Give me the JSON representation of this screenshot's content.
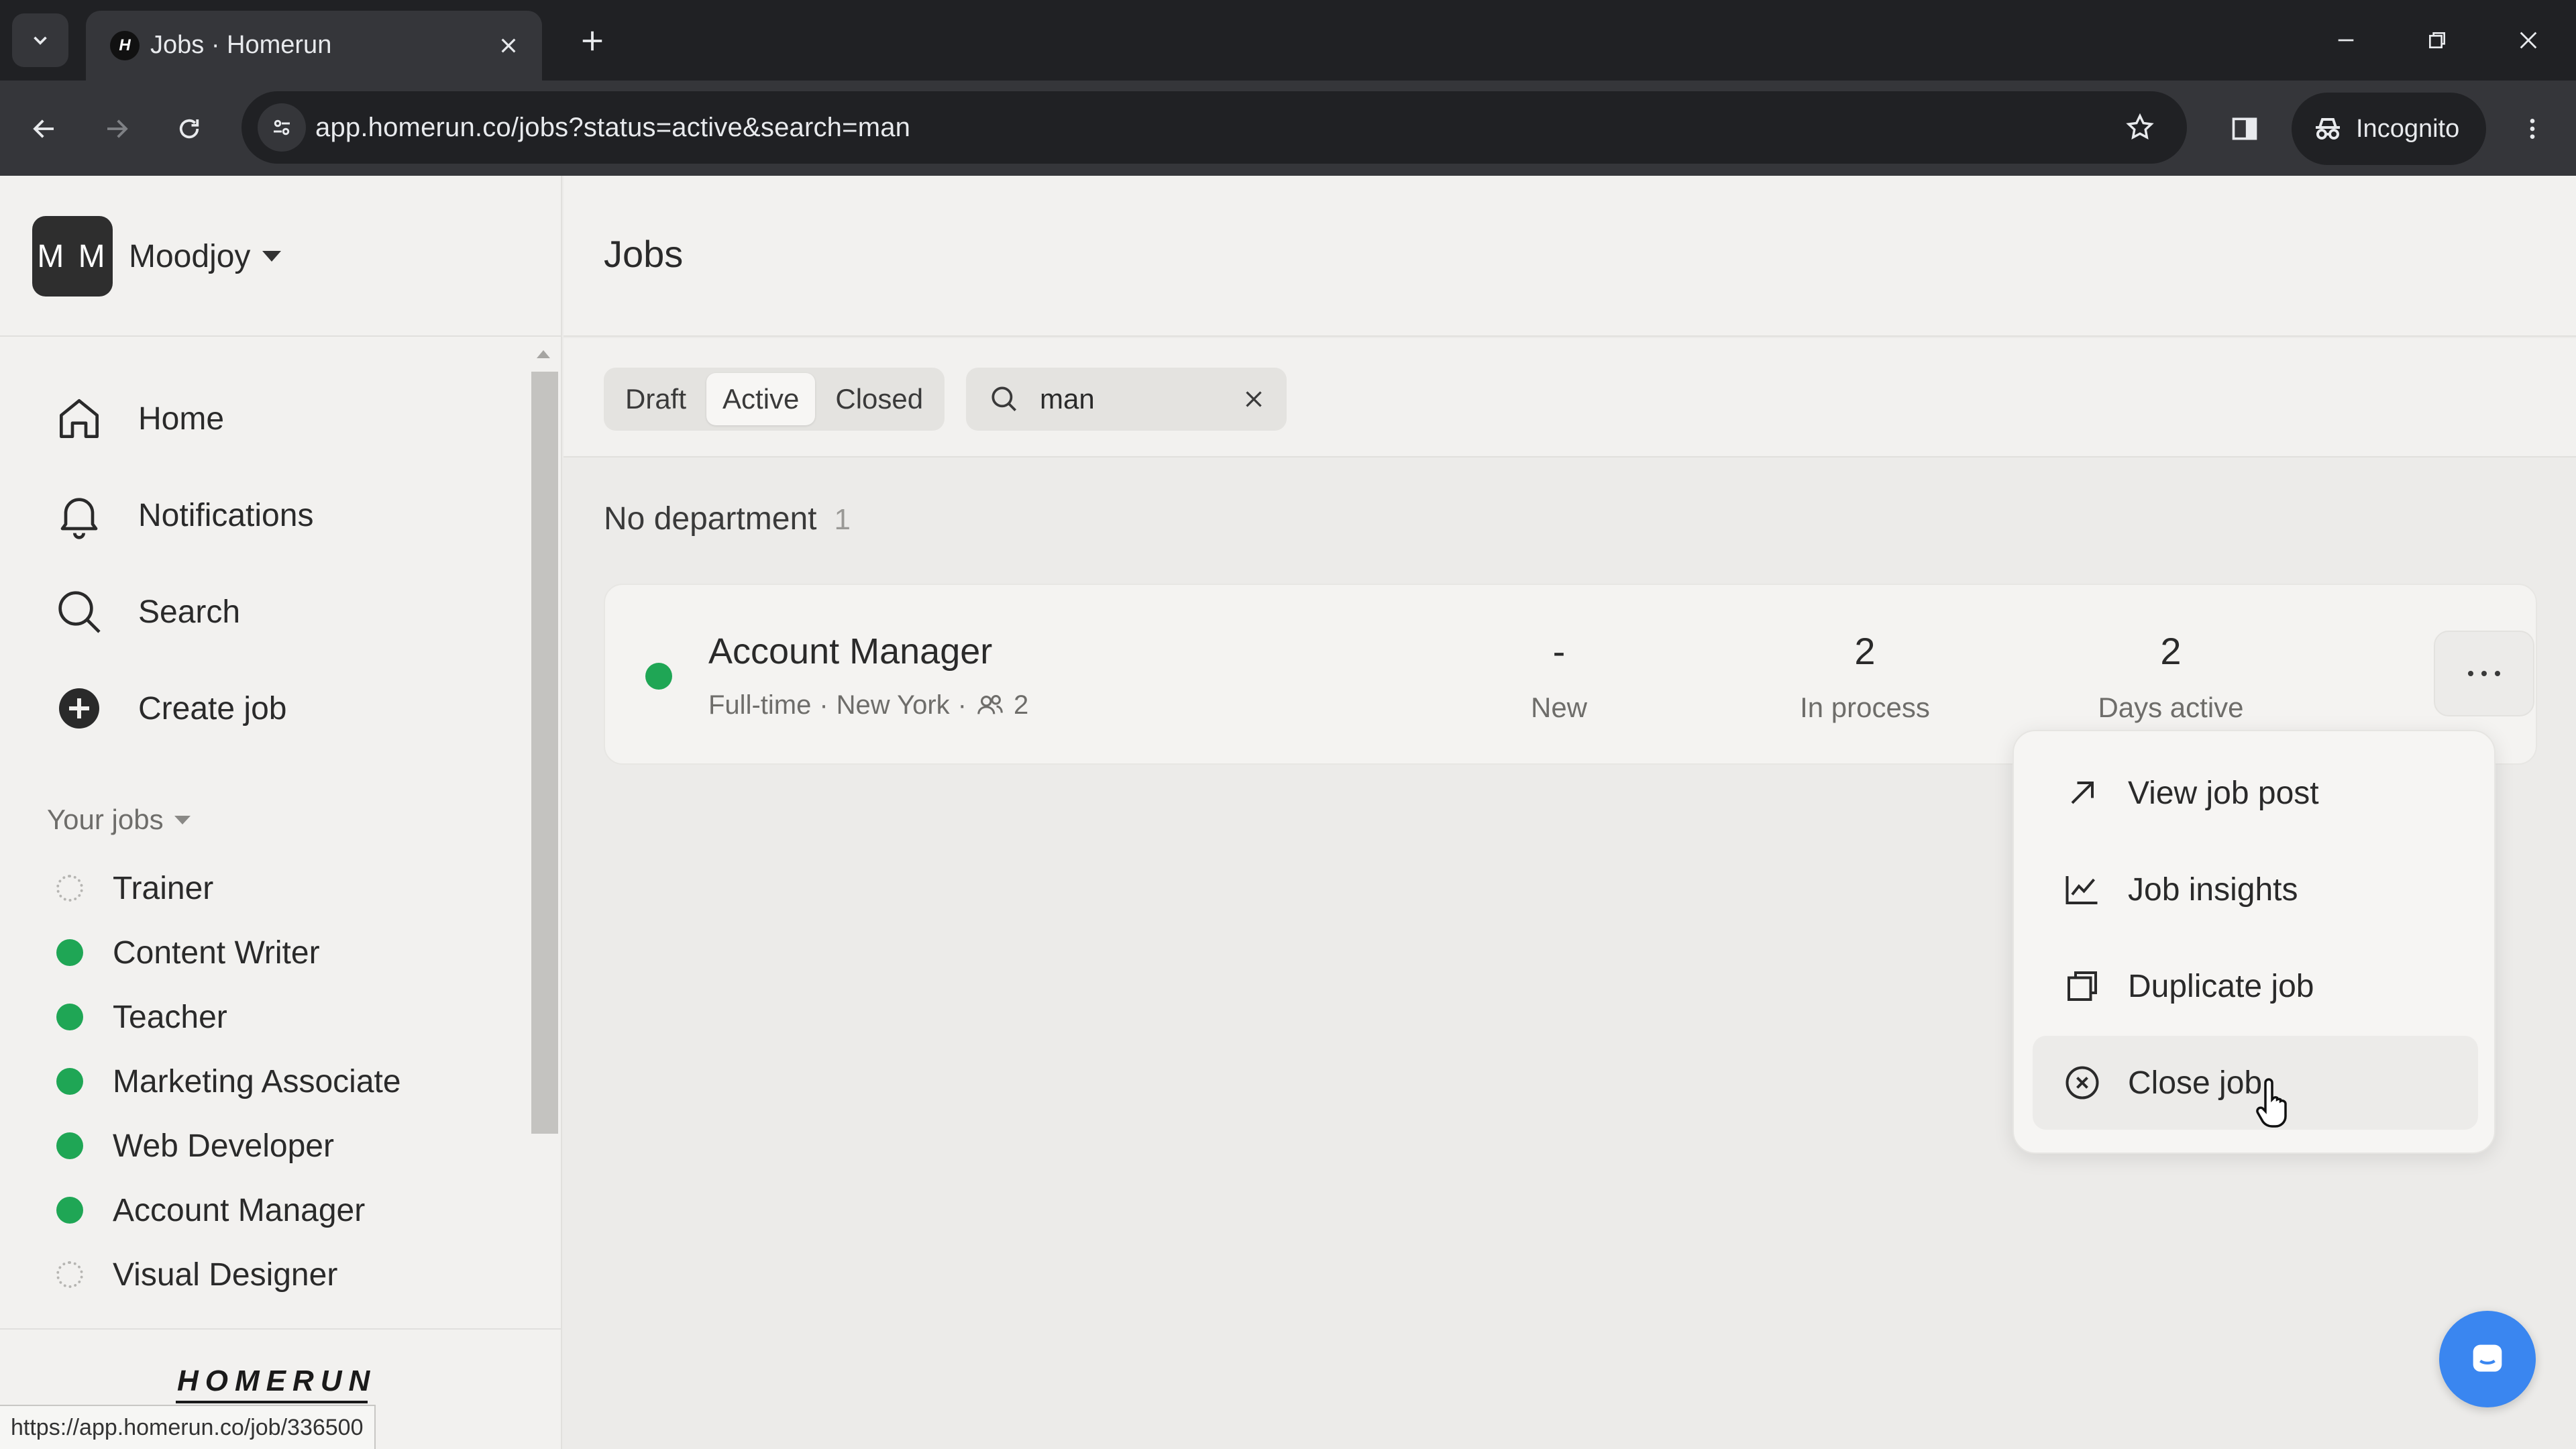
{
  "browser": {
    "tab_title": "Jobs · Homerun",
    "favicon_letter": "H",
    "url": "app.homerun.co/jobs?status=active&search=man",
    "incognito_label": "Incognito"
  },
  "sidebar": {
    "org_initials": "M M",
    "org_name": "Moodjoy",
    "nav": [
      {
        "label": "Home",
        "icon": "home-icon"
      },
      {
        "label": "Notifications",
        "icon": "bell-icon"
      },
      {
        "label": "Search",
        "icon": "search-icon"
      },
      {
        "label": "Create job",
        "icon": "plus-circle-icon"
      }
    ],
    "your_jobs_label": "Your jobs",
    "jobs": [
      {
        "label": "Trainer",
        "status": "draft"
      },
      {
        "label": "Content Writer",
        "status": "active"
      },
      {
        "label": "Teacher",
        "status": "active"
      },
      {
        "label": "Marketing Associate",
        "status": "active"
      },
      {
        "label": "Web Developer",
        "status": "active"
      },
      {
        "label": "Account Manager",
        "status": "active"
      },
      {
        "label": "Visual Designer",
        "status": "draft"
      }
    ],
    "logo_text": "HOMERUN"
  },
  "main": {
    "title": "Jobs",
    "filters": {
      "draft": "Draft",
      "active": "Active",
      "closed": "Closed",
      "selected": "Active"
    },
    "search": {
      "value": "man"
    },
    "department": {
      "name": "No department",
      "count": "1"
    },
    "job_card": {
      "title": "Account Manager",
      "type": "Full-time",
      "location": "New York",
      "team_count": "2",
      "stats": [
        {
          "value": "-",
          "label": "New"
        },
        {
          "value": "2",
          "label": "In process"
        },
        {
          "value": "2",
          "label": "Days active"
        }
      ]
    },
    "menu": [
      {
        "label": "View job post",
        "icon": "arrow-up-right-icon"
      },
      {
        "label": "Job insights",
        "icon": "chart-line-icon"
      },
      {
        "label": "Duplicate job",
        "icon": "copy-icon"
      },
      {
        "label": "Close job",
        "icon": "x-circle-icon"
      }
    ]
  },
  "status_url": "https://app.homerun.co/job/336500",
  "colors": {
    "active_dot": "#1fa655",
    "chat_button": "#3a86f0",
    "chrome_dark": "#202124"
  }
}
